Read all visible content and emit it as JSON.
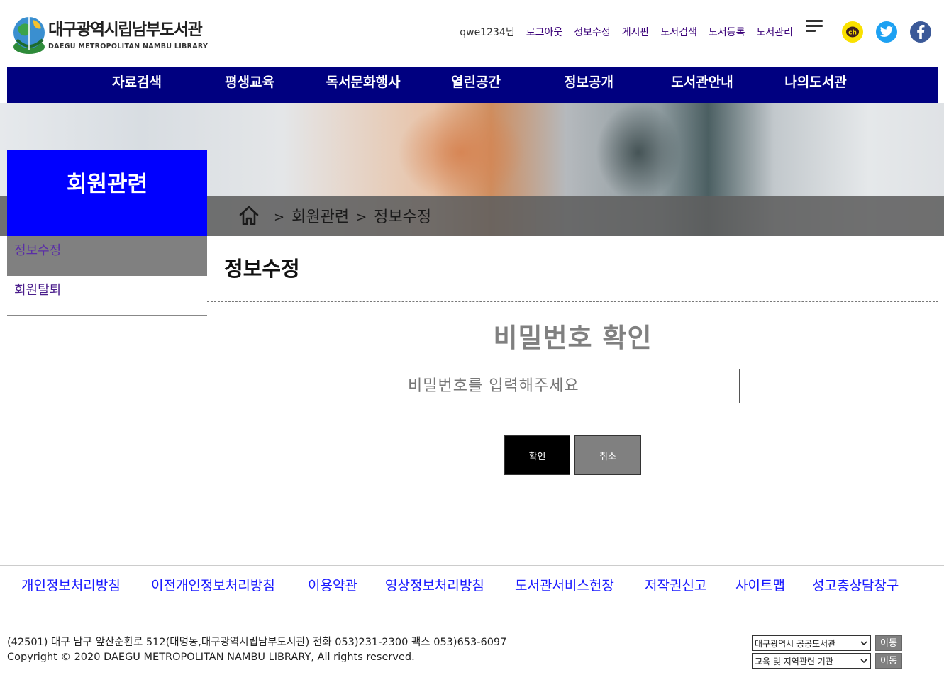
{
  "logo": {
    "title": "대구광역시립남부도서관",
    "subtitle": "DAEGU METROPOLITAN NAMBU LIBRARY"
  },
  "util": {
    "user": "qwe1234님",
    "links": [
      "로그아웃",
      "정보수정",
      "게시판",
      "도서검색",
      "도서등록",
      "도서관리"
    ],
    "icons": [
      "menu-icon",
      "kakao-channel-icon",
      "twitter-icon",
      "facebook-icon"
    ],
    "kakao_glyph": "ch"
  },
  "gnb": {
    "items": [
      "자료검색",
      "평생교육",
      "독서문화행사",
      "열린공간",
      "정보공개",
      "도서관안내",
      "나의도서관"
    ],
    "color": "#000080"
  },
  "breadcrumb": {
    "items": [
      "회원관련",
      "정보수정"
    ],
    "separator": ">"
  },
  "side": {
    "title": "회원관련",
    "items": [
      "정보수정",
      "회원탈퇴"
    ],
    "active_index": 0,
    "title_color": "#0000ff"
  },
  "main": {
    "page_title": "정보수정",
    "heading": "비밀번호 확인",
    "password_placeholder": "비밀번호를 입력해주세요",
    "confirm_label": "확인",
    "cancel_label": "취소"
  },
  "footer": {
    "links": [
      "개인정보처리방침",
      "이전개인정보처리방침",
      "이용약관",
      "영상정보처리방침",
      "도서관서비스헌장",
      "저작권신고",
      "사이트맵",
      "성고충상담창구"
    ],
    "address": "(42501) 대구 남구 앞산순환로 512(대명동,대구광역시립남부도서관) 전화 053)231-2300 팩스 053)653-6097",
    "copyright": "Copyright © 2020 DAEGU METROPOLITAN NAMBU LIBRARY, All rights reserved.",
    "family_sites": [
      {
        "selected": "대구광역시 공공도서관",
        "button": "이동"
      },
      {
        "selected": "교육 및 지역관련 기관",
        "button": "이동"
      }
    ]
  }
}
